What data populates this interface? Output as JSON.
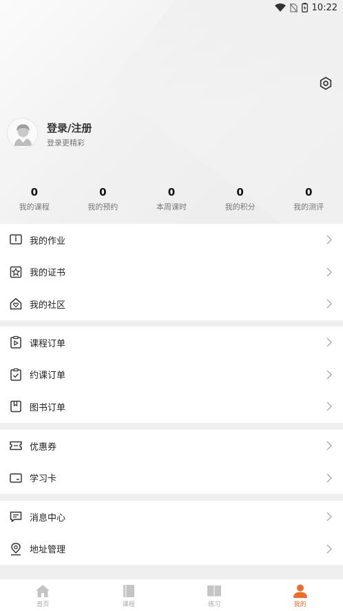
{
  "status_bar": {
    "time": "10:22"
  },
  "profile": {
    "title": "登录/注册",
    "subtitle": "登录更精彩"
  },
  "stats": [
    {
      "value": "0",
      "label": "我的课程"
    },
    {
      "value": "0",
      "label": "我的预约"
    },
    {
      "value": "0",
      "label": "本周课时"
    },
    {
      "value": "0",
      "label": "我的积分"
    },
    {
      "value": "0",
      "label": "我的测评"
    }
  ],
  "menu": {
    "homework": "我的作业",
    "certificate": "我的证书",
    "community": "我的社区",
    "course_orders": "课程订单",
    "booking_orders": "约课订单",
    "book_orders": "图书订单",
    "coupons": "优惠券",
    "study_card": "学习卡",
    "messages": "消息中心",
    "address": "地址管理"
  },
  "tabs": [
    {
      "label": "首页",
      "icon": "home-icon"
    },
    {
      "label": "课程",
      "icon": "book-icon"
    },
    {
      "label": "练习",
      "icon": "practice-icon"
    },
    {
      "label": "我的",
      "icon": "person-icon",
      "active": true
    }
  ],
  "colors": {
    "accent": "#f06a2a",
    "tab_inactive": "#c4c4c4"
  }
}
